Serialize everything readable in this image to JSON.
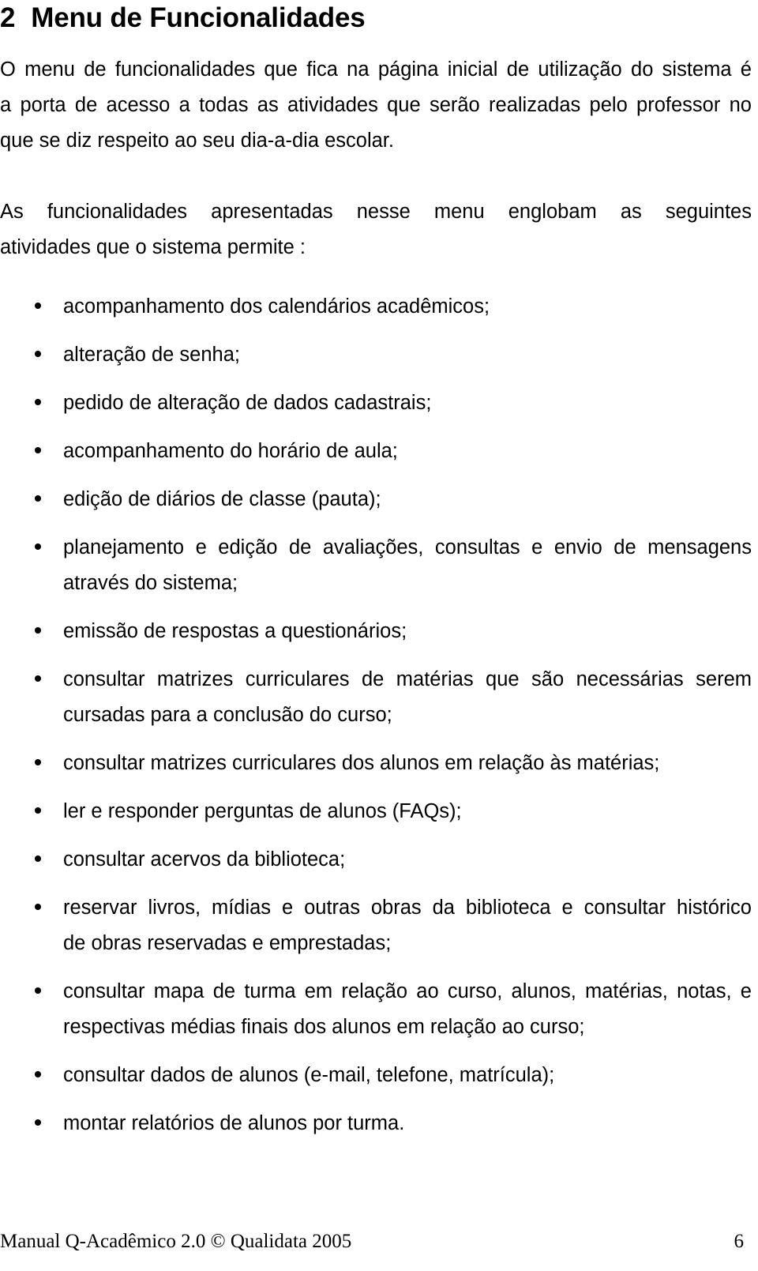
{
  "document": {
    "heading": {
      "number": "2",
      "title": "Menu de Funcionalidades"
    },
    "paragraphs": [
      {
        "id": "intro",
        "lines": [
          "O menu de funcionalidades que fica na página inicial de utilização do sistema é",
          "a porta de acesso a todas as atividades que serão realizadas pelo professor no",
          "que se diz respeito ao seu dia-a-dia escolar."
        ]
      },
      {
        "id": "lead-in",
        "lines": [
          "As funcionalidades apresentadas nesse menu englobam as seguintes",
          "atividades que o sistema permite :"
        ]
      }
    ],
    "bullets": [
      {
        "lines": [
          "acompanhamento dos calendários acadêmicos;"
        ]
      },
      {
        "lines": [
          "alteração de senha;"
        ]
      },
      {
        "lines": [
          "pedido de alteração de dados cadastrais;"
        ]
      },
      {
        "lines": [
          "acompanhamento do horário de aula;"
        ]
      },
      {
        "lines": [
          "edição de diários de classe (pauta);"
        ]
      },
      {
        "lines": [
          "planejamento e edição de avaliações, consultas e envio de mensagens",
          "através do sistema;"
        ]
      },
      {
        "lines": [
          "emissão de respostas a questionários;"
        ]
      },
      {
        "lines": [
          "consultar matrizes curriculares de matérias que são necessárias serem",
          "cursadas para a conclusão do curso;"
        ]
      },
      {
        "lines": [
          "consultar matrizes curriculares dos alunos em relação às matérias;"
        ]
      },
      {
        "lines": [
          "ler e responder perguntas de alunos (FAQs);"
        ]
      },
      {
        "lines": [
          "consultar acervos da biblioteca;"
        ]
      },
      {
        "lines": [
          "reservar livros, mídias e outras obras da biblioteca e consultar histórico",
          "de obras reservadas e emprestadas;"
        ]
      },
      {
        "lines": [
          "consultar mapa de turma em relação ao curso, alunos, matérias, notas, e",
          "respectivas médias finais dos alunos em relação ao curso;"
        ]
      },
      {
        "lines": [
          "consultar dados de alunos (e-mail, telefone, matrícula);"
        ]
      },
      {
        "lines": [
          "montar relatórios de alunos por turma."
        ]
      }
    ],
    "footer": {
      "left": "Manual Q-Acadêmico 2.0 © Qualidata 2005",
      "page_number": "6"
    }
  }
}
